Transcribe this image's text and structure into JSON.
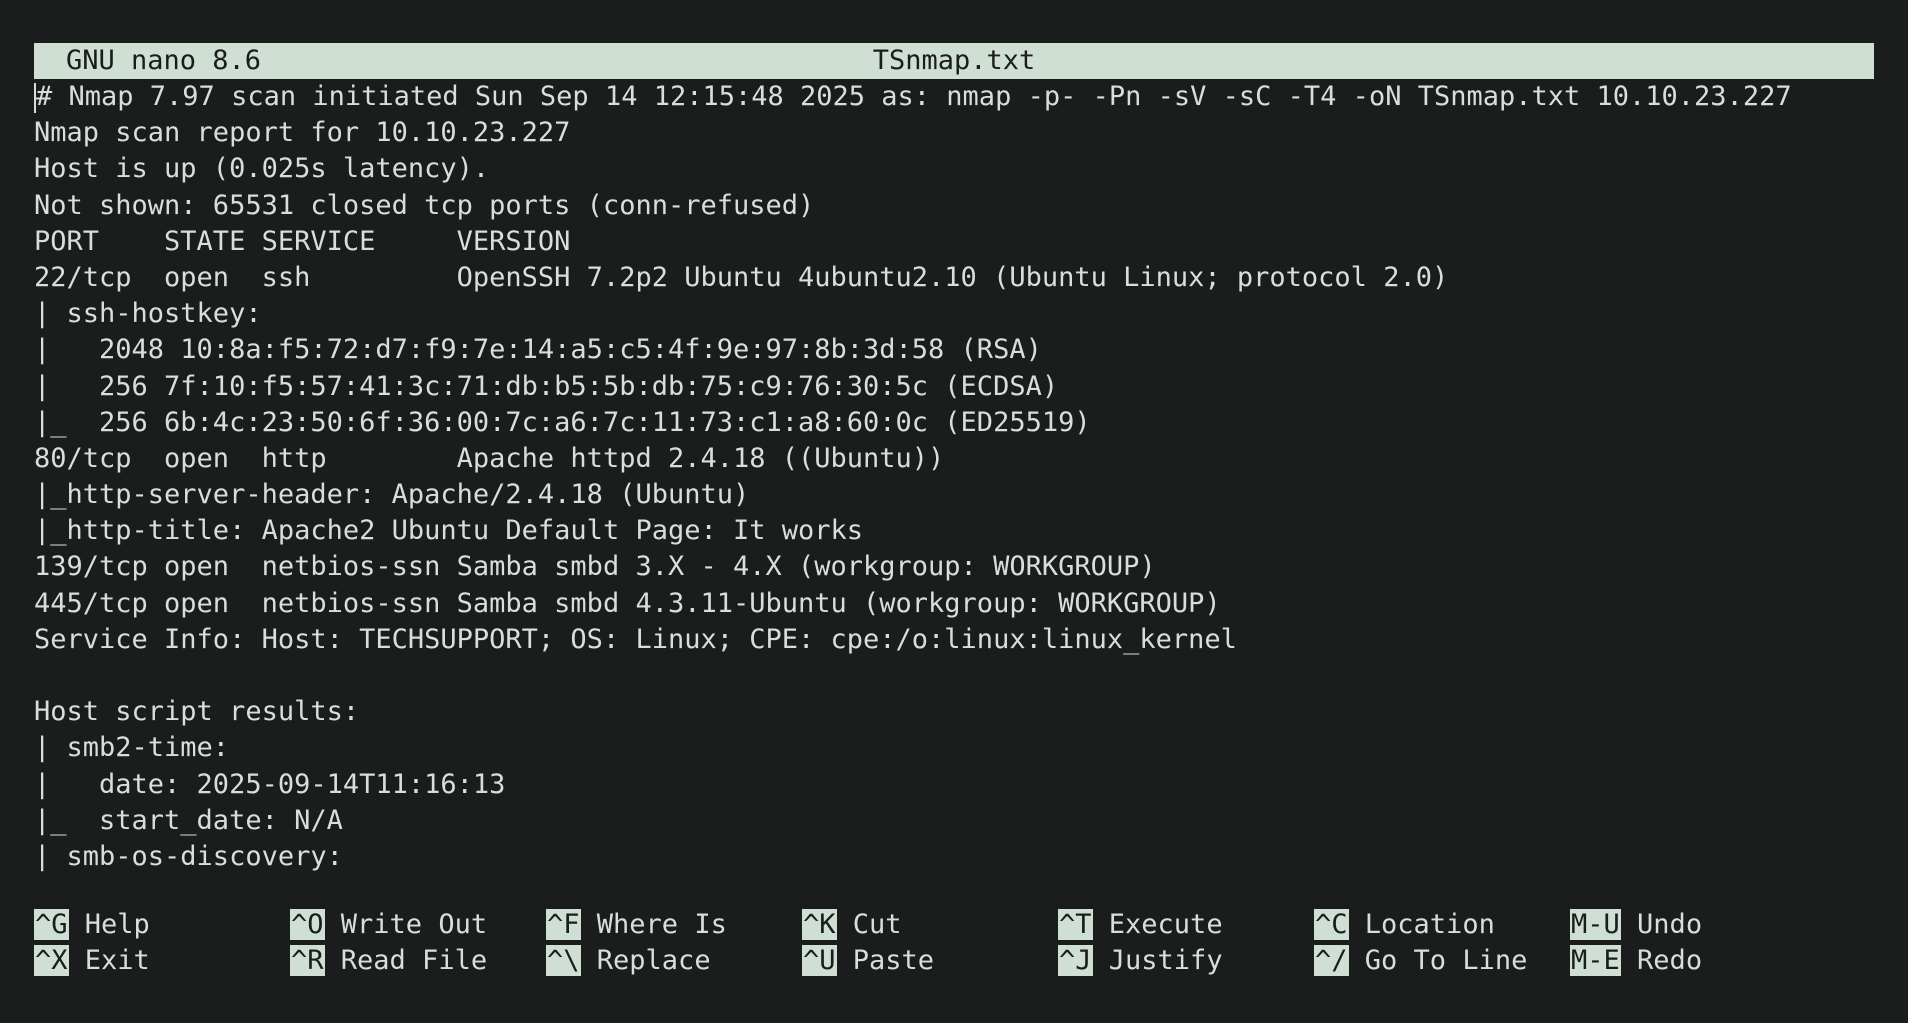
{
  "titlebar": {
    "app_version": "GNU nano 8.6",
    "filename": "TSnmap.txt"
  },
  "lines": [
    "# Nmap 7.97 scan initiated Sun Sep 14 12:15:48 2025 as: nmap -p- -Pn -sV -sC -T4 -oN TSnmap.txt 10.10.23.227",
    "Nmap scan report for 10.10.23.227",
    "Host is up (0.025s latency).",
    "Not shown: 65531 closed tcp ports (conn-refused)",
    "PORT    STATE SERVICE     VERSION",
    "22/tcp  open  ssh         OpenSSH 7.2p2 Ubuntu 4ubuntu2.10 (Ubuntu Linux; protocol 2.0)",
    "| ssh-hostkey:",
    "|   2048 10:8a:f5:72:d7:f9:7e:14:a5:c5:4f:9e:97:8b:3d:58 (RSA)",
    "|   256 7f:10:f5:57:41:3c:71:db:b5:5b:db:75:c9:76:30:5c (ECDSA)",
    "|_  256 6b:4c:23:50:6f:36:00:7c:a6:7c:11:73:c1:a8:60:0c (ED25519)",
    "80/tcp  open  http        Apache httpd 2.4.18 ((Ubuntu))",
    "|_http-server-header: Apache/2.4.18 (Ubuntu)",
    "|_http-title: Apache2 Ubuntu Default Page: It works",
    "139/tcp open  netbios-ssn Samba smbd 3.X - 4.X (workgroup: WORKGROUP)",
    "445/tcp open  netbios-ssn Samba smbd 4.3.11-Ubuntu (workgroup: WORKGROUP)",
    "Service Info: Host: TECHSUPPORT; OS: Linux; CPE: cpe:/o:linux:linux_kernel",
    "",
    "Host script results:",
    "| smb2-time:",
    "|   date: 2025-09-14T11:16:13",
    "|_  start_date: N/A",
    "| smb-os-discovery:"
  ],
  "shortcuts": {
    "row1": [
      {
        "key": "^G",
        "label": "Help"
      },
      {
        "key": "^O",
        "label": "Write Out"
      },
      {
        "key": "^F",
        "label": "Where Is"
      },
      {
        "key": "^K",
        "label": "Cut"
      },
      {
        "key": "^T",
        "label": "Execute"
      },
      {
        "key": "^C",
        "label": "Location"
      },
      {
        "key": "M-U",
        "label": "Undo"
      }
    ],
    "row2": [
      {
        "key": "^X",
        "label": "Exit"
      },
      {
        "key": "^R",
        "label": "Read File"
      },
      {
        "key": "^\\",
        "label": "Replace"
      },
      {
        "key": "^U",
        "label": "Paste"
      },
      {
        "key": "^J",
        "label": "Justify"
      },
      {
        "key": "^/",
        "label": "Go To Line"
      },
      {
        "key": "M-E",
        "label": "Redo"
      }
    ]
  },
  "colors": {
    "background": "#1b1c1c",
    "foreground": "#d9dedb",
    "highlight": "#cfdfd3"
  }
}
